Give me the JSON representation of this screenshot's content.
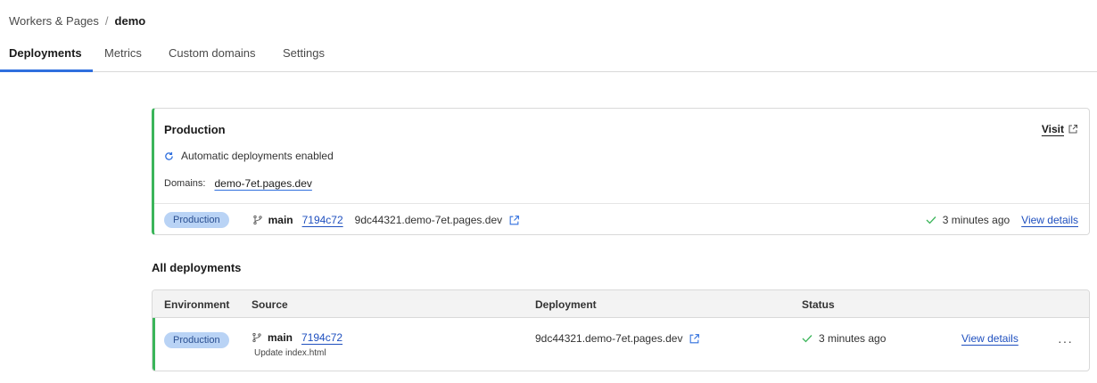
{
  "breadcrumb": {
    "parent": "Workers & Pages",
    "separator": "/",
    "current": "demo"
  },
  "tabs": [
    {
      "label": "Deployments",
      "active": true
    },
    {
      "label": "Metrics",
      "active": false
    },
    {
      "label": "Custom domains",
      "active": false
    },
    {
      "label": "Settings",
      "active": false
    }
  ],
  "production": {
    "title": "Production",
    "visit_label": "Visit",
    "auto_deploy": "Automatic deployments enabled",
    "domains_label": "Domains:",
    "domain": "demo-7et.pages.dev",
    "latest": {
      "environment": "Production",
      "branch": "main",
      "commit": "7194c72",
      "deployment_url": "9dc44321.demo-7et.pages.dev",
      "status": "3 minutes ago",
      "view_details": "View details"
    }
  },
  "all_deployments": {
    "title": "All deployments",
    "columns": [
      "Environment",
      "Source",
      "Deployment",
      "Status"
    ],
    "rows": [
      {
        "environment": "Production",
        "branch": "main",
        "commit": "7194c72",
        "message": "Update index.html",
        "deployment_url": "9dc44321.demo-7et.pages.dev",
        "status": "3 minutes ago",
        "view_details": "View details",
        "more": "···"
      }
    ]
  },
  "icons": {
    "branch": "git-branch-icon",
    "external": "external-link-icon",
    "refresh": "refresh-icon",
    "check": "check-icon"
  },
  "colors": {
    "accent": "#2f6fde",
    "success": "#3bb55a",
    "badge_bg": "#b9d3f5"
  }
}
